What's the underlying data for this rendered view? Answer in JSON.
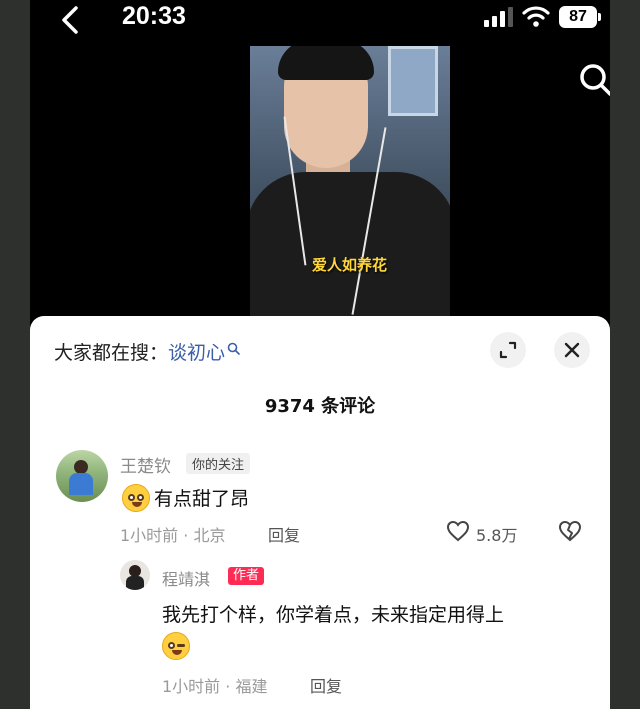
{
  "status_bar": {
    "time": "20:33",
    "battery": "87"
  },
  "video": {
    "caption": "爱人如养花"
  },
  "comments_sheet": {
    "search_prefix": "大家都在搜：",
    "search_keyword": "谈初心",
    "comment_count": "9374 条评论",
    "comment": {
      "user": "王楚钦",
      "tag": "你的关注",
      "text": "有点甜了昂",
      "meta": "1小时前 · 北京",
      "reply_label": "回复",
      "likes": "5.8万"
    },
    "reply": {
      "user": "程靖淇",
      "tag": "作者",
      "text": "我先打个样，你学着点，未来指定用得上",
      "meta": "1小时前 · 福建",
      "reply_label": "回复"
    }
  },
  "colors": {
    "accent_pink": "#fe2c55",
    "search_blue": "#3a5fa8",
    "caption_yellow": "#ffd73a"
  }
}
